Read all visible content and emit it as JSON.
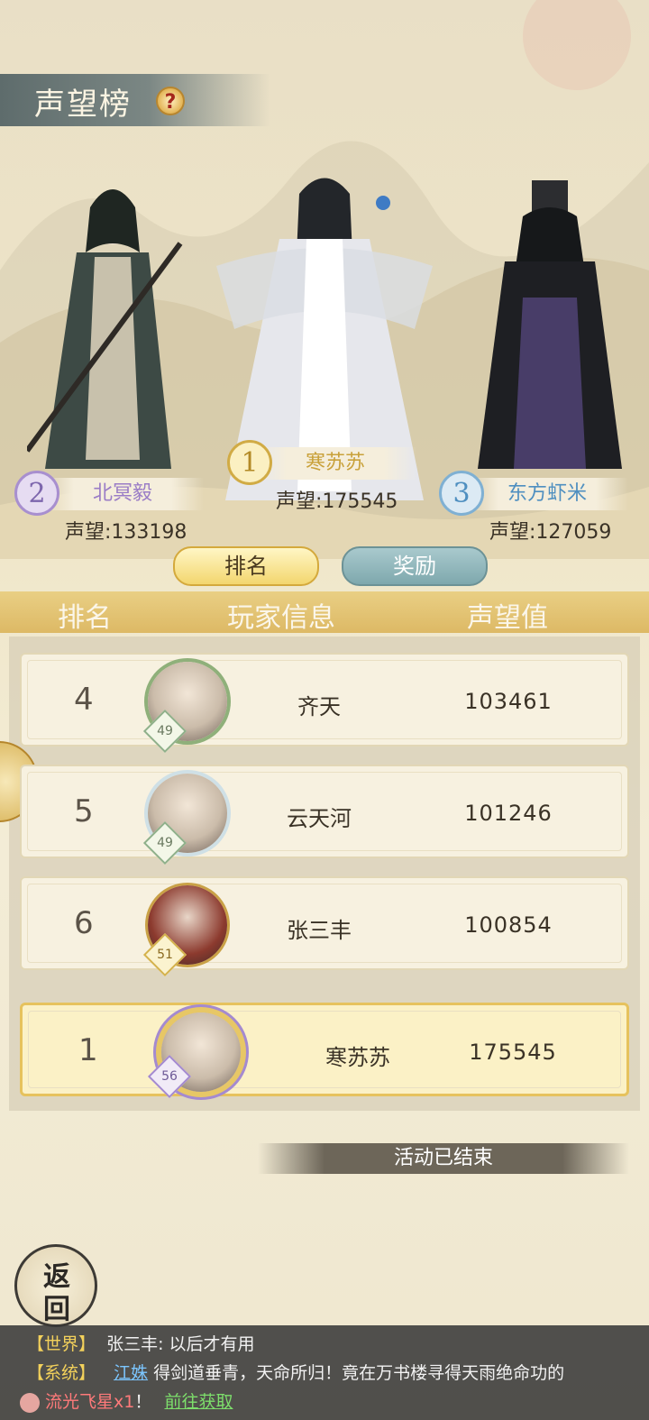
{
  "header": {
    "title": "声望榜",
    "help_icon": "question-icon"
  },
  "top3": [
    {
      "rank": "2",
      "name": "北冥毅",
      "reputation": "声望:133198",
      "color": "#9a7cc6"
    },
    {
      "rank": "1",
      "name": "寒苏苏",
      "reputation": "声望:175545",
      "color": "#c9a13a"
    },
    {
      "rank": "3",
      "name": "东方虾米",
      "reputation": "声望:127059",
      "color": "#4f8fc0"
    }
  ],
  "tabs": {
    "rank": "排名",
    "reward": "奖励"
  },
  "table_header": {
    "rank": "排名",
    "player": "玩家信息",
    "value": "声望值"
  },
  "rows": [
    {
      "rank": "4",
      "level": "49",
      "name": "齐天",
      "value": "103461"
    },
    {
      "rank": "5",
      "level": "49",
      "name": "云天河",
      "value": "101246"
    },
    {
      "rank": "6",
      "level": "51",
      "name": "张三丰",
      "value": "100854"
    }
  ],
  "me": {
    "rank": "1",
    "level": "56",
    "name": "寒苏苏",
    "value": "175545"
  },
  "status": "活动已结束",
  "back": {
    "line1": "返",
    "line2": "回"
  },
  "chat": {
    "world_tag": "【世界】",
    "world_msg": "张三丰: 以后才有用",
    "system_tag": "【系统】",
    "system_user": "江姝",
    "system_msg": "得剑道垂青，天命所归！竟在万书楼寻得天雨绝命功的",
    "item": "流光飞星x1",
    "item_suffix": "！",
    "goto": "前往获取"
  }
}
